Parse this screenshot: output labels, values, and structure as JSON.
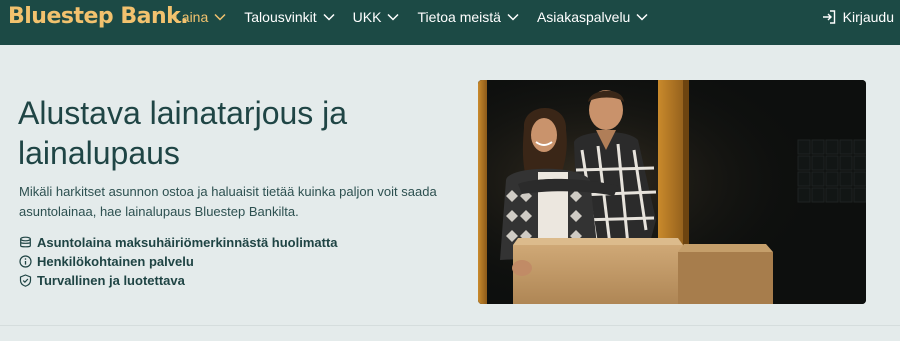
{
  "brand": {
    "name": "Bluestep Bank."
  },
  "nav": {
    "items": [
      {
        "label": "Laina",
        "active": true
      },
      {
        "label": "Talousvinkit",
        "active": false
      },
      {
        "label": "UKK",
        "active": false
      },
      {
        "label": "Tietoa meistä",
        "active": false
      },
      {
        "label": "Asiakaspalvelu",
        "active": false
      }
    ],
    "login_label": "Kirjaudu"
  },
  "hero": {
    "title": "Alustava lainatarjous ja lainalupaus",
    "description": "Mikäli harkitset asunnon ostoa ja haluaisit tietää kuinka paljon voit saada asuntolainaa, hae lainalupaus Bluestep Bankilta.",
    "features": [
      {
        "icon": "coins-icon",
        "text": "Asuntolaina maksuhäiriömerkinnästä huolimatta"
      },
      {
        "icon": "info-icon",
        "text": "Henkilökohtainen palvelu"
      },
      {
        "icon": "shield-check-icon",
        "text": "Turvallinen ja luotettava"
      }
    ],
    "image_icon": "couple-with-moving-boxes-photo"
  },
  "colors": {
    "topbar": "#1c4a45",
    "brand_accent": "#f2c26e",
    "page_background": "#e4ebeb",
    "text": "#1f4545"
  }
}
